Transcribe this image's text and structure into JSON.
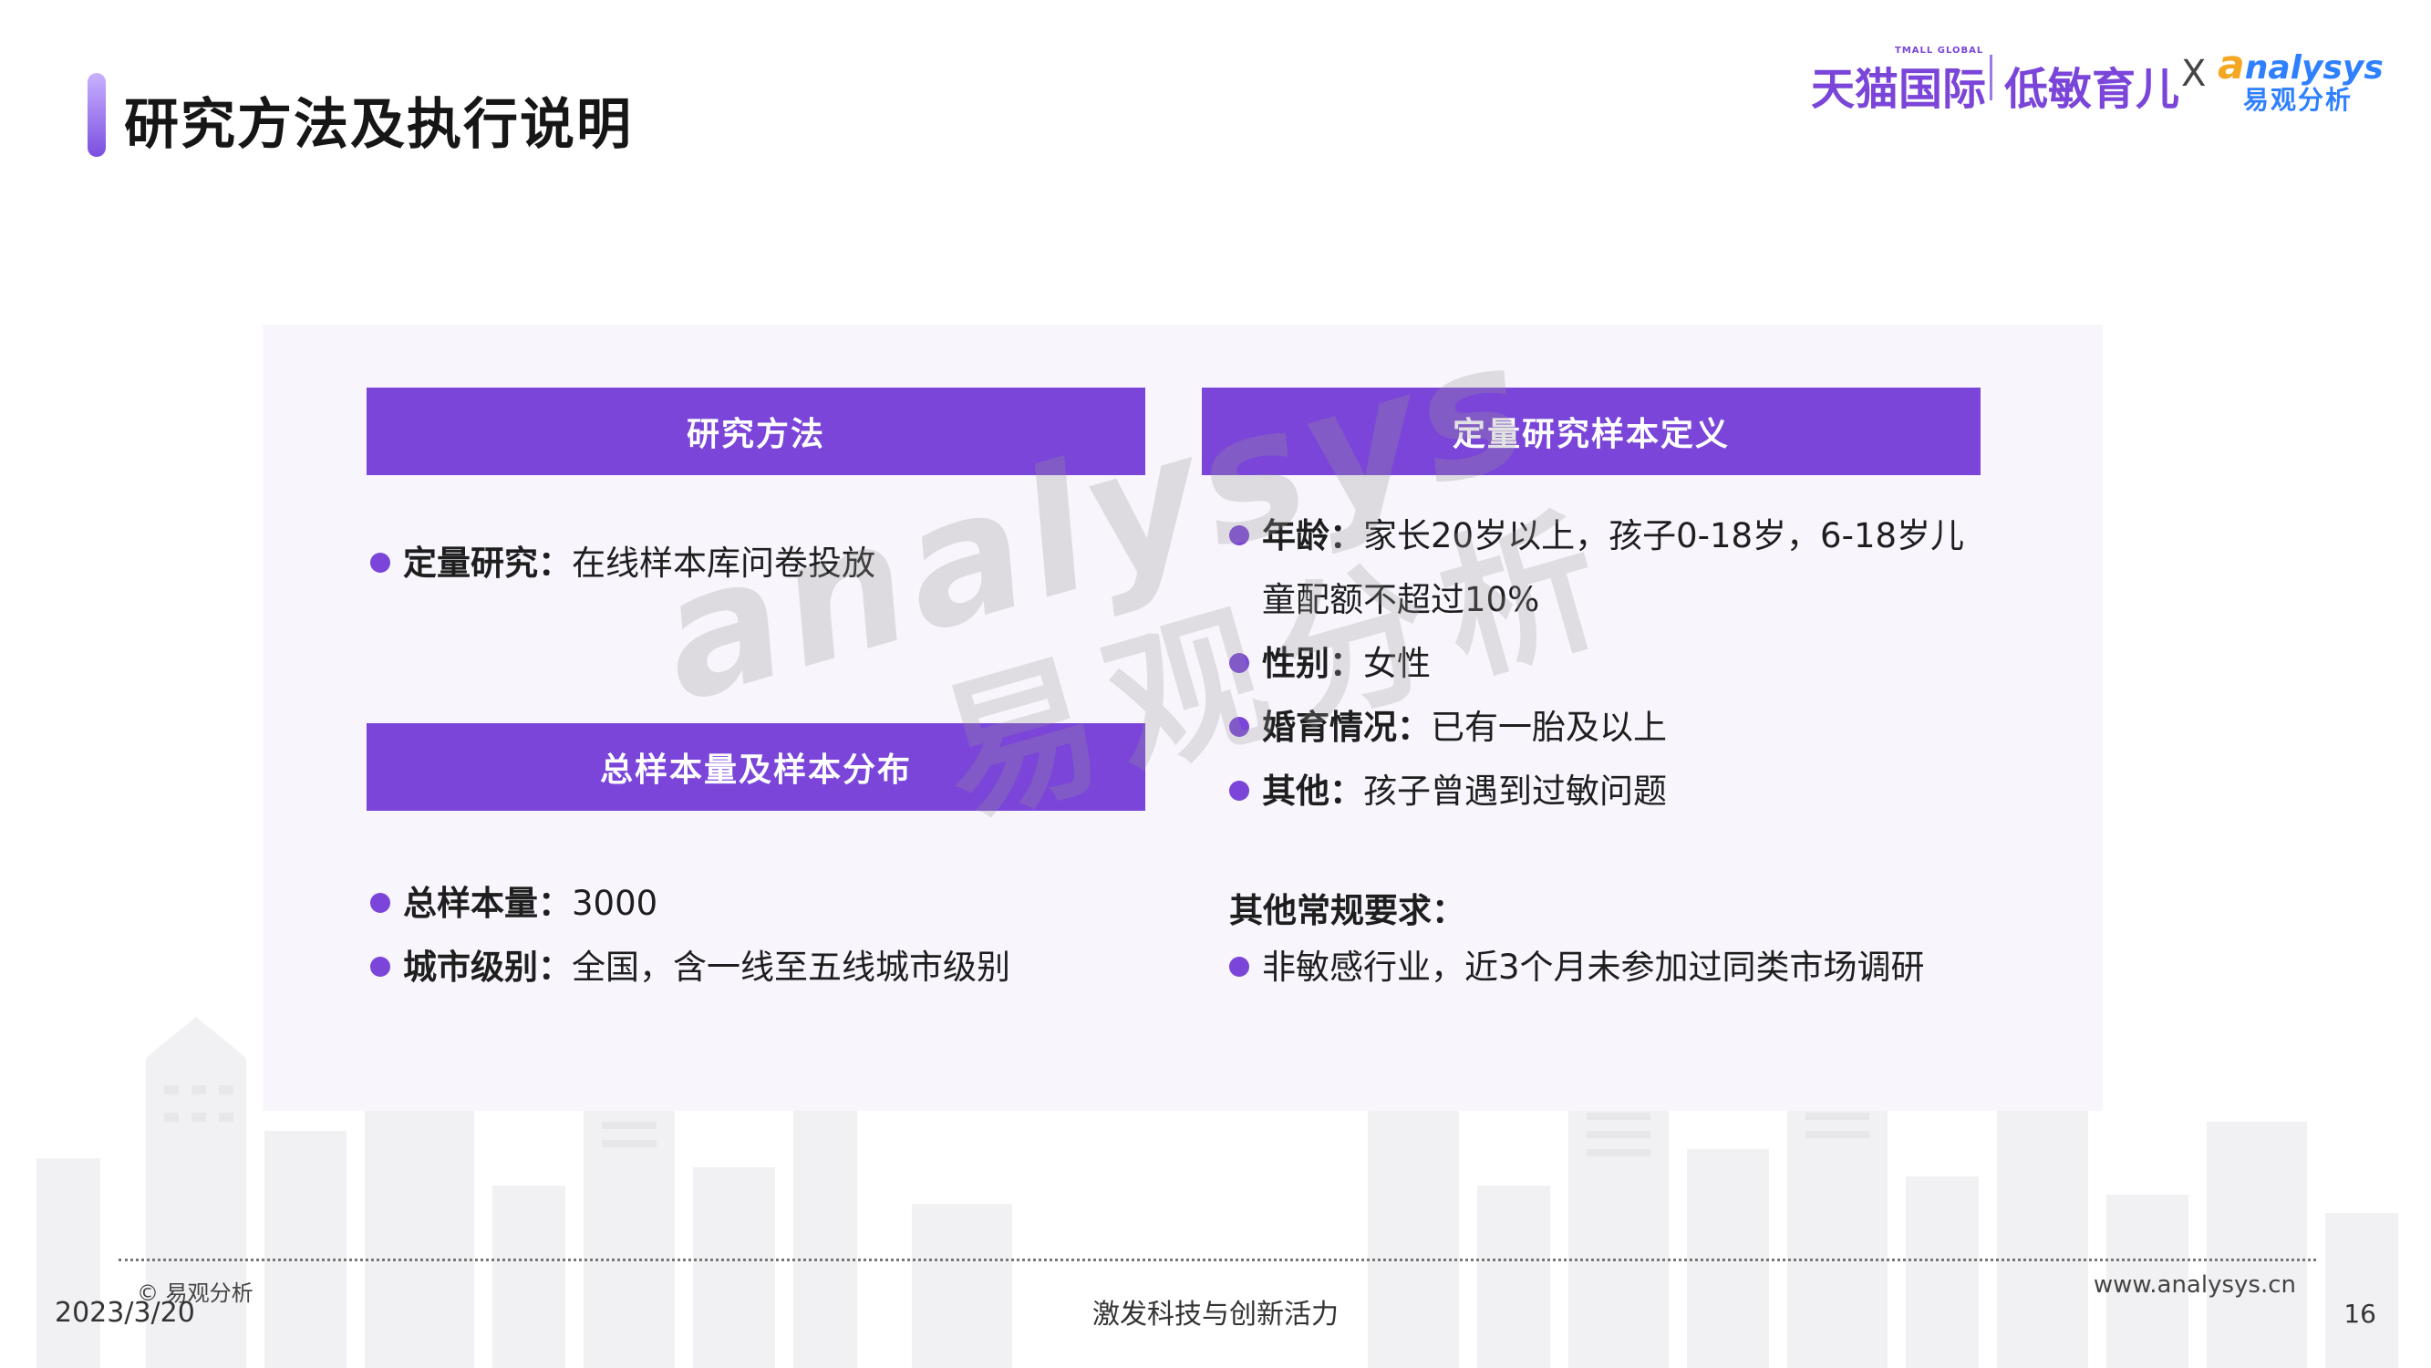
{
  "header": {
    "title": "研究方法及执行说明"
  },
  "logos": {
    "tmall": "天猫国际",
    "tmall_small": "TMALL GLOBAL",
    "low_allergy": "低敏育儿",
    "x": "X",
    "analysys_a": "a",
    "analysys_rest": "nalysys",
    "analysys_cn": "易观分析"
  },
  "left": {
    "method_header": "研究方法",
    "method_bullet_key": "定量研究：",
    "method_bullet_text": "在线样本库问卷投放",
    "sample_header": "总样本量及样本分布",
    "sample_bullets": [
      {
        "key": "总样本量：",
        "text": "3000"
      },
      {
        "key": "城市级别：",
        "text": "全国，含一线至五线城市级别"
      }
    ]
  },
  "right": {
    "definition_header": "定量研究样本定义",
    "age_key": "年龄：",
    "age_text": "家长20岁以上，孩子0-18岁，6-18岁儿",
    "age_cont": "童配额不超过10%",
    "gender_key": "性别：",
    "gender_text": "女性",
    "marital_key": "婚育情况：",
    "marital_text": "已有一胎及以上",
    "other_key": "其他：",
    "other_text": "孩子曾遇到过敏问题",
    "other_req_heading": "其他常规要求：",
    "other_req_text": "非敏感行业，近3个月未参加过同类市场调研"
  },
  "watermark": {
    "en": "analysys",
    "cn": "易观分析"
  },
  "footer": {
    "copyright": "© 易观分析",
    "date": "2023/3/20",
    "slogan": "激发科技与创新活力",
    "website": "www.analysys.cn",
    "page": "16"
  },
  "colors": {
    "accent": "#7a45d8",
    "panel_bg": "#f8f5fd",
    "analysys_blue": "#2f80ff",
    "analysys_orange": "#f5a623"
  }
}
